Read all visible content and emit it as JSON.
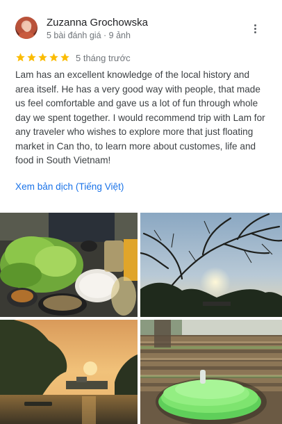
{
  "review": {
    "reviewer_name": "Zuzanna Grochowska",
    "reviewer_meta": "5 bài đánh giá · 9 ảnh",
    "rating": 5,
    "date": "5 tháng trước",
    "text": "Lam has an excellent knowledge of the local history and area itself. He has a very good way with people, that made us feel comfortable and gave us a lot of fun through whole day we spent together. I would recommend trip with Lam for any traveler who wishes to explore more that just floating market in Can tho, to learn more about customes, life and food in South Vietnam!",
    "translate_link": "Xem bản dịch (Tiếng Việt)"
  },
  "icons": {
    "menu": "more-vert-icon",
    "star": "star-icon"
  },
  "colors": {
    "star": "#fbbc04",
    "link": "#1a73e8",
    "secondary_text": "#70757a"
  }
}
